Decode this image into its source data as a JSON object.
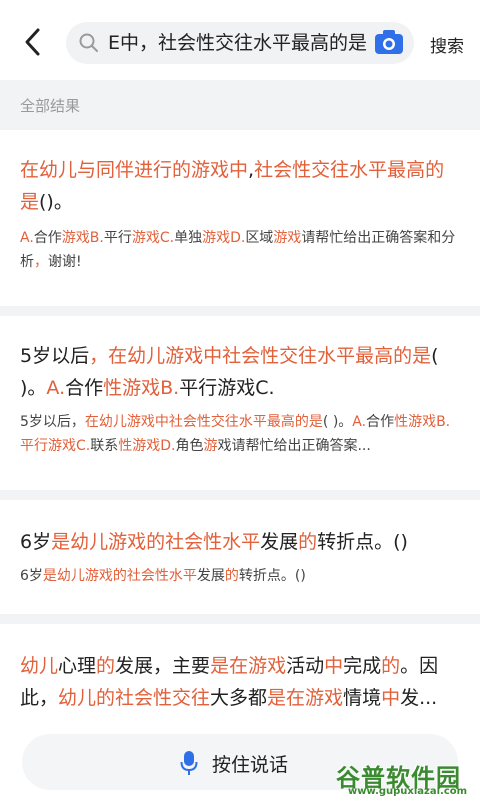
{
  "header": {
    "search_query": "E中，社会性交往水平最高的是",
    "search_button": "搜索"
  },
  "section_label": "全部结果",
  "results": [
    {
      "title": [
        {
          "t": "在幼儿与同伴进行的游戏中",
          "h": true
        },
        {
          "t": ",",
          "h": false
        },
        {
          "t": "社会性交往水平最高的是",
          "h": true
        },
        {
          "t": "()。",
          "h": false
        }
      ],
      "snippet": [
        {
          "t": "A.",
          "h": true
        },
        {
          "t": "合作",
          "h": false
        },
        {
          "t": "游戏B.",
          "h": true
        },
        {
          "t": "平行",
          "h": false
        },
        {
          "t": "游戏C.",
          "h": true
        },
        {
          "t": "单独",
          "h": false
        },
        {
          "t": "游戏D.",
          "h": true
        },
        {
          "t": "区域",
          "h": false
        },
        {
          "t": "游戏",
          "h": true
        },
        {
          "t": "请帮忙给出正确答案和分析",
          "h": false
        },
        {
          "t": "，",
          "h": true
        },
        {
          "t": "谢谢!",
          "h": false
        }
      ]
    },
    {
      "title": [
        {
          "t": "5岁以后",
          "h": false
        },
        {
          "t": "，",
          "h": true
        },
        {
          "t": "在幼儿游戏中社会性交往水平最高的是",
          "h": true
        },
        {
          "t": "( )。",
          "h": false
        },
        {
          "t": "A.",
          "h": true
        },
        {
          "t": "合作",
          "h": false
        },
        {
          "t": "性游戏B.",
          "h": true
        },
        {
          "t": "平行游戏C.",
          "h": false
        }
      ],
      "snippet": [
        {
          "t": "5岁以后，",
          "h": false
        },
        {
          "t": "在幼儿游戏中社会性交往水平最高的是",
          "h": true
        },
        {
          "t": "( )。",
          "h": false
        },
        {
          "t": "A.",
          "h": true
        },
        {
          "t": "合作",
          "h": false
        },
        {
          "t": "性游戏B.平行游戏C.",
          "h": true
        },
        {
          "t": "联系",
          "h": false
        },
        {
          "t": "性游戏D.",
          "h": true
        },
        {
          "t": "角色",
          "h": false
        },
        {
          "t": "游",
          "h": true
        },
        {
          "t": "戏请帮忙给出正确答案...",
          "h": false
        }
      ]
    },
    {
      "title": [
        {
          "t": "6岁",
          "h": false
        },
        {
          "t": "是幼儿游戏的社会性水平",
          "h": true
        },
        {
          "t": "发展",
          "h": false
        },
        {
          "t": "的",
          "h": true
        },
        {
          "t": "转折点。()",
          "h": false
        }
      ],
      "snippet": [
        {
          "t": "6岁",
          "h": false
        },
        {
          "t": "是幼儿游戏的社会性水平",
          "h": true
        },
        {
          "t": "发展",
          "h": false
        },
        {
          "t": "的",
          "h": true
        },
        {
          "t": "转折点。()",
          "h": false
        }
      ]
    },
    {
      "title": [
        {
          "t": "幼儿",
          "h": true
        },
        {
          "t": "心理",
          "h": false
        },
        {
          "t": "的",
          "h": true
        },
        {
          "t": "发展，主要",
          "h": false
        },
        {
          "t": "是在游戏",
          "h": true
        },
        {
          "t": "活动",
          "h": false
        },
        {
          "t": "中",
          "h": true
        },
        {
          "t": "完成",
          "h": false
        },
        {
          "t": "的",
          "h": true
        },
        {
          "t": "。因此，",
          "h": false
        },
        {
          "t": "幼儿的社会性交往",
          "h": true
        },
        {
          "t": "大多都",
          "h": false
        },
        {
          "t": "是在游戏",
          "h": true
        },
        {
          "t": "情境",
          "h": false
        },
        {
          "t": "中",
          "h": true
        },
        {
          "t": "发...",
          "h": false
        }
      ],
      "snippet": []
    }
  ],
  "voice_button": "按住说话",
  "watermark": {
    "title": "谷普软件园",
    "url": "www.gupuxiazai.com"
  },
  "colors": {
    "highlight": "#e2603a",
    "camera": "#2f6fe8",
    "mic": "#2f6fe8",
    "watermark": "#3a8a2f"
  }
}
